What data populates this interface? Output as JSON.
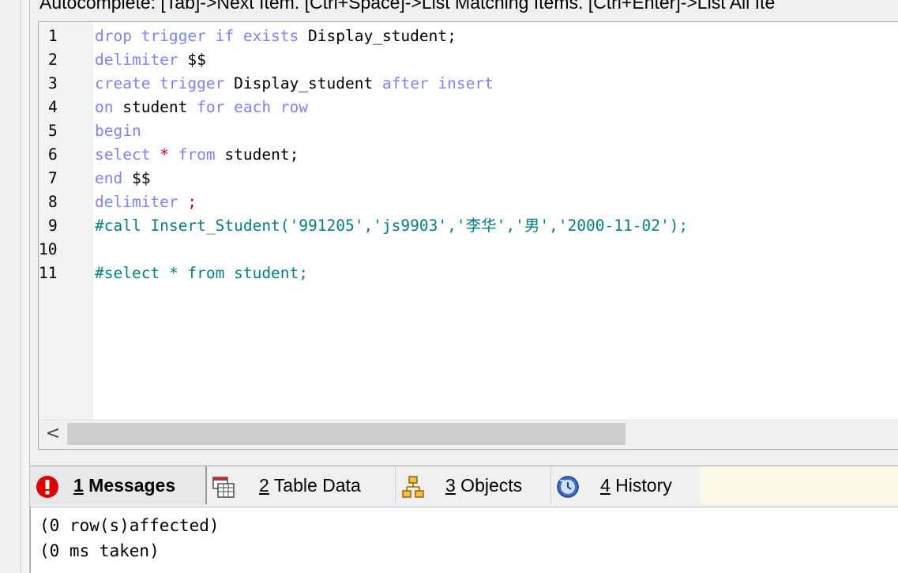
{
  "hint_bar": {
    "text": "Autocomplete: [Tab]->Next Item. [Ctrl+Space]->List Matching Items. [Ctrl+Enter]->List All Ite"
  },
  "editor": {
    "lines": [
      {
        "num": "1",
        "tokens": [
          {
            "t": "kw",
            "v": "drop trigger if exists"
          },
          {
            "t": "id",
            "v": " Display_student;"
          }
        ]
      },
      {
        "num": "2",
        "tokens": [
          {
            "t": "kw",
            "v": "delimiter"
          },
          {
            "t": "id",
            "v": " $$"
          }
        ]
      },
      {
        "num": "3",
        "tokens": [
          {
            "t": "kw",
            "v": "create trigger"
          },
          {
            "t": "id",
            "v": " Display_student "
          },
          {
            "t": "kw",
            "v": "after insert"
          }
        ]
      },
      {
        "num": "4",
        "tokens": [
          {
            "t": "kw",
            "v": "on"
          },
          {
            "t": "id",
            "v": " student "
          },
          {
            "t": "kw",
            "v": "for each row"
          }
        ]
      },
      {
        "num": "5",
        "tokens": [
          {
            "t": "kw",
            "v": "begin"
          }
        ]
      },
      {
        "num": "6",
        "tokens": [
          {
            "t": "kw",
            "v": "select"
          },
          {
            "t": "op",
            "v": " * "
          },
          {
            "t": "kw",
            "v": "from"
          },
          {
            "t": "id",
            "v": " student;"
          }
        ]
      },
      {
        "num": "7",
        "tokens": [
          {
            "t": "kw",
            "v": "end"
          },
          {
            "t": "id",
            "v": " $$"
          }
        ]
      },
      {
        "num": "8",
        "tokens": [
          {
            "t": "kw",
            "v": "delimiter"
          },
          {
            "t": "op",
            "v": " ;"
          }
        ]
      },
      {
        "num": "9",
        "tokens": [
          {
            "t": "cm",
            "v": "#call Insert_Student('991205','js9903','李华','男','2000-11-02');"
          }
        ]
      },
      {
        "num": "10",
        "tokens": []
      },
      {
        "num": "11",
        "tokens": [
          {
            "t": "cm",
            "v": "#select * from student;"
          }
        ]
      }
    ]
  },
  "scrollbar": {
    "left_arrow": "<"
  },
  "tabs": [
    {
      "key": "1",
      "label": " Messages",
      "icon": "error-icon",
      "active": true
    },
    {
      "key": "2",
      "label": " Table Data",
      "icon": "table-data-icon",
      "active": false
    },
    {
      "key": "3",
      "label": " Objects",
      "icon": "objects-icon",
      "active": false
    },
    {
      "key": "4",
      "label": " History",
      "icon": "history-icon",
      "active": false
    }
  ],
  "messages": {
    "lines": [
      "(0 row(s)affected)",
      "(0 ms taken)"
    ]
  },
  "colors": {
    "keyword": "#7f7fff",
    "identifier": "#000000",
    "operator": "#c00000",
    "comment": "#008080",
    "error_icon": "#e00000"
  }
}
